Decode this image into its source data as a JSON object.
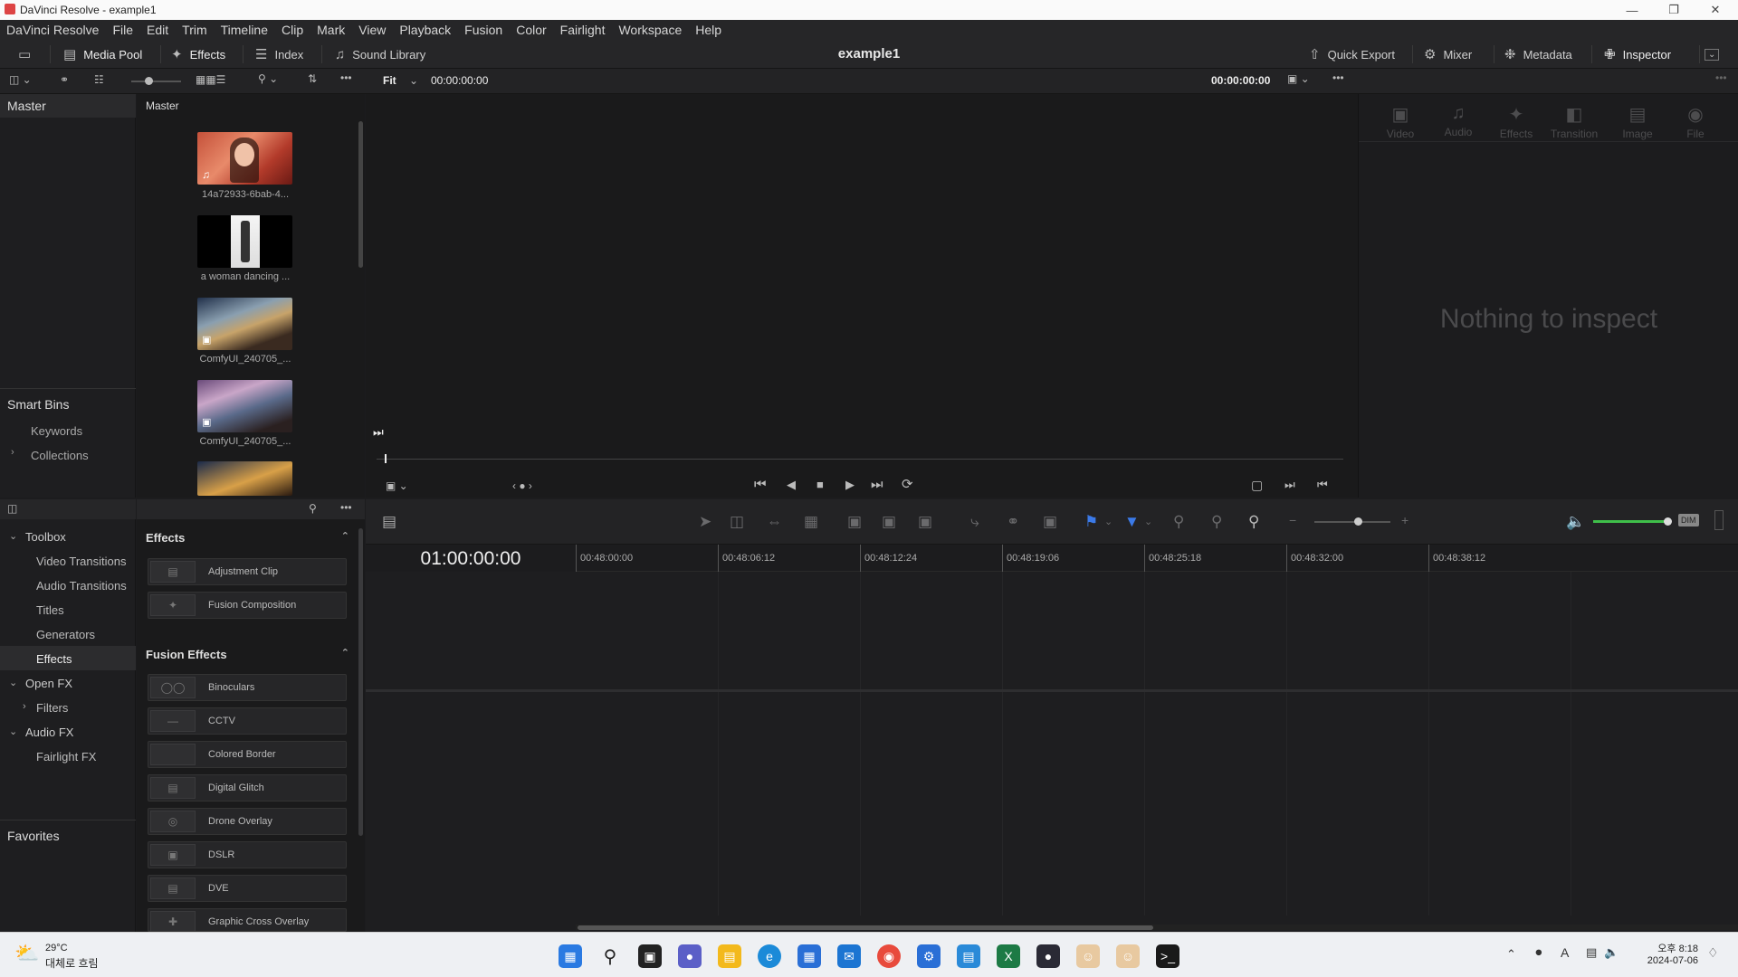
{
  "window": {
    "title": "DaVinci Resolve - example1"
  },
  "menu": [
    "DaVinci Resolve",
    "File",
    "Edit",
    "Trim",
    "Timeline",
    "Clip",
    "Mark",
    "View",
    "Playback",
    "Fusion",
    "Color",
    "Fairlight",
    "Workspace",
    "Help"
  ],
  "toolbar": {
    "media_pool": "Media Pool",
    "effects": "Effects",
    "index": "Index",
    "sound_library": "Sound Library",
    "project_title": "example1",
    "quick_export": "Quick Export",
    "mixer": "Mixer",
    "metadata": "Metadata",
    "inspector": "Inspector"
  },
  "viewer": {
    "zoom": "Fit",
    "timecode_left": "00:00:00:00",
    "timecode_right": "00:00:00:00"
  },
  "bins": {
    "master": "Master",
    "smart_bins": "Smart Bins",
    "keywords": "Keywords",
    "collections": "Collections"
  },
  "mediapool": {
    "header": "Master",
    "clips": [
      {
        "label": "14a72933-6bab-4..."
      },
      {
        "label": "a woman dancing ..."
      },
      {
        "label": "ComfyUI_240705_..."
      },
      {
        "label": "ComfyUI_240705_..."
      }
    ]
  },
  "inspector": {
    "tabs": [
      "Video",
      "Audio",
      "Effects",
      "Transition",
      "Image",
      "File"
    ],
    "empty": "Nothing to inspect"
  },
  "toolbox": {
    "toolbox": "Toolbox",
    "video_transitions": "Video Transitions",
    "audio_transitions": "Audio Transitions",
    "titles": "Titles",
    "generators": "Generators",
    "effects": "Effects",
    "open_fx": "Open FX",
    "filters": "Filters",
    "audio_fx": "Audio FX",
    "fairlight_fx": "Fairlight FX",
    "favorites": "Favorites"
  },
  "effects": {
    "section1": "Effects",
    "items1": [
      "Adjustment Clip",
      "Fusion Composition"
    ],
    "section2": "Fusion Effects",
    "items2": [
      "Binoculars",
      "CCTV",
      "Colored Border",
      "Digital Glitch",
      "Drone Overlay",
      "DSLR",
      "DVE",
      "Graphic Cross Overlay"
    ]
  },
  "timeline": {
    "timecode": "01:00:00:00",
    "ticks": [
      "00:48:00:00",
      "00:48:06:12",
      "00:48:12:24",
      "00:48:19:06",
      "00:48:25:18",
      "00:48:32:00",
      "00:48:38:12"
    ],
    "dim": "DIM"
  },
  "taskbar": {
    "temp": "29°C",
    "weather": "대체로 흐림",
    "time": "오후 8:18",
    "date": "2024-07-06"
  }
}
